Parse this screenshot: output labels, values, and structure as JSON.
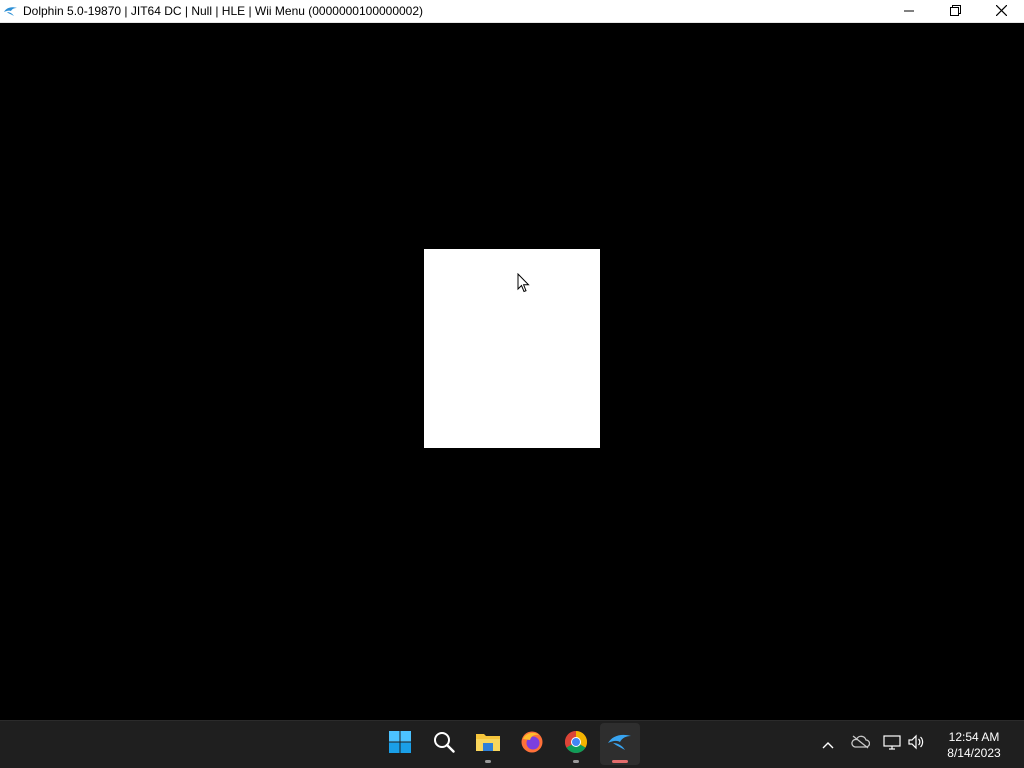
{
  "window": {
    "title": "Dolphin 5.0-19870 | JIT64 DC | Null | HLE | Wii Menu (0000000100000002)",
    "icon": "dolphin-icon",
    "controls": [
      "minimize-icon",
      "restore-icon",
      "close-icon"
    ]
  },
  "taskbar": {
    "apps": [
      {
        "name": "start",
        "icon": "windows-logo-icon"
      },
      {
        "name": "search",
        "icon": "search-icon"
      },
      {
        "name": "file-explorer",
        "icon": "folder-icon",
        "running": true
      },
      {
        "name": "firefox",
        "icon": "firefox-icon"
      },
      {
        "name": "chrome",
        "icon": "chrome-icon",
        "running": true
      },
      {
        "name": "dolphin",
        "icon": "dolphin-icon",
        "running": true,
        "active": true
      }
    ],
    "tray": [
      "chevron-up-icon",
      "onedrive-offline-icon",
      "network-icon",
      "speaker-icon"
    ],
    "clock": {
      "time": "12:54 AM",
      "date": "8/14/2023"
    }
  },
  "colors": {
    "accent": "#0078d4",
    "active_indicator": "#e36c6c",
    "taskbar_bg": "#1f1f1f"
  }
}
